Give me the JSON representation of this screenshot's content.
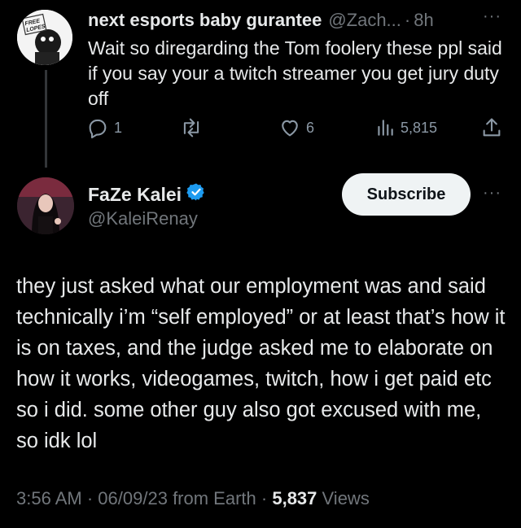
{
  "tweet1": {
    "display_name": "next esports baby gurantee",
    "handle": "@Zach...",
    "separator": "·",
    "time": "8h",
    "more": "···",
    "avatar_text": "FREE LOPES",
    "text": "Wait so diregarding the Tom foolery these ppl said if you say your a twitch streamer you get jury duty off",
    "actions": {
      "replies": "1",
      "retweets": "",
      "likes": "6",
      "views": "5,815"
    }
  },
  "tweet2": {
    "display_name": "FaZe Kalei",
    "handle": "@KaleiRenay",
    "subscribe_label": "Subscribe",
    "more": "···",
    "verified_color": "#1d9bf0",
    "text": "they just asked what our employment was and said technically i’m “self employed” or at least that’s how it is on taxes, and the judge asked me to elaborate on how it works, videogames, twitch, how i get paid etc so i did. some other guy also got excused with me, so idk lol",
    "meta": {
      "time": "3:56 AM",
      "sep1": "·",
      "date": "06/09/23",
      "source": "from Earth",
      "sep2": "·",
      "views_count": "5,837",
      "views_label": "Views"
    }
  },
  "icons": [
    "reply-icon",
    "retweet-icon",
    "like-icon",
    "views-icon",
    "share-icon",
    "verified-badge-icon"
  ]
}
